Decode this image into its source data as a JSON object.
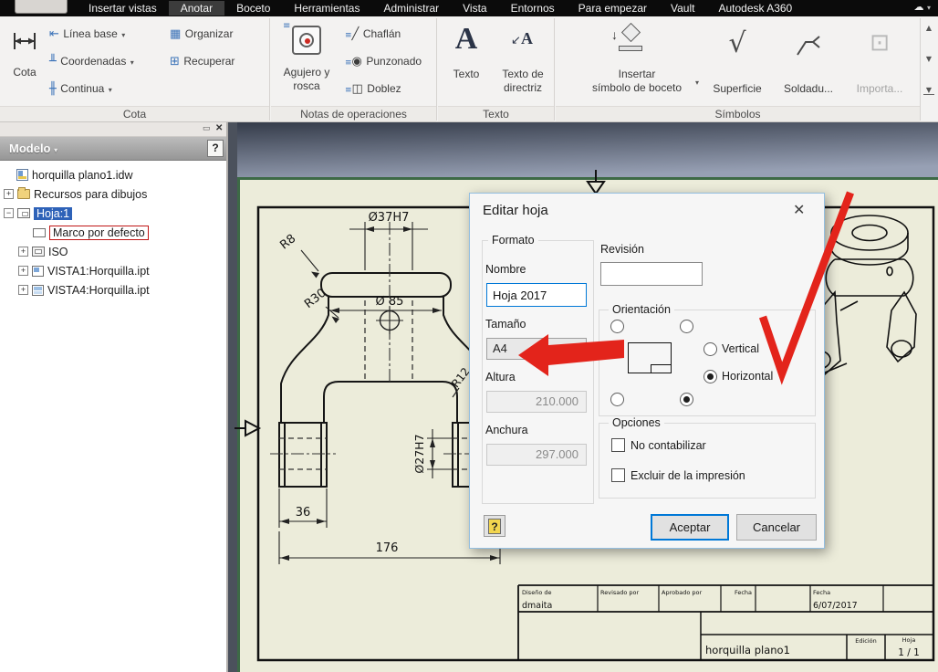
{
  "app": {
    "tabs": {
      "items": [
        "Insertar vistas",
        "Anotar",
        "Boceto",
        "Herramientas",
        "Administrar",
        "Vista",
        "Entornos",
        "Para empezar",
        "Vault",
        "Autodesk A360"
      ],
      "active": "Anotar"
    }
  },
  "ribbon": {
    "groups": {
      "cota": "Cota",
      "notas": "Notas de operaciones",
      "texto": "Texto",
      "simbolos": "Símbolos"
    },
    "cota": {
      "main": "Cota",
      "linea_base": "Línea base",
      "coordenadas": "Coordenadas",
      "continua": "Continua",
      "organizar": "Organizar",
      "recuperar": "Recuperar"
    },
    "notas": {
      "agujero_l1": "Agujero y",
      "agujero_l2": "rosca",
      "chaflan": "Chaflán",
      "punzonado": "Punzonado",
      "doblez": "Doblez"
    },
    "texto": {
      "texto": "Texto",
      "directriz_l1": "Texto de",
      "directriz_l2": "directriz"
    },
    "simbolos": {
      "insertar_l1": "Insertar",
      "insertar_l2": "símbolo de boceto",
      "superficie": "Superficie",
      "soldadura": "Soldadu...",
      "importar": "Importa..."
    }
  },
  "panel": {
    "title": "Modelo",
    "items": [
      {
        "label": "horquilla plano1.idw"
      },
      {
        "label": "Recursos para dibujos"
      },
      {
        "label": "Hoja:1"
      },
      {
        "label": "Marco por defecto"
      },
      {
        "label": "ISO"
      },
      {
        "label": "VISTA1:Horquilla.ipt"
      },
      {
        "label": "VISTA4:Horquilla.ipt"
      }
    ]
  },
  "dialog": {
    "title": "Editar hoja",
    "formato_label": "Formato",
    "nombre_label": "Nombre",
    "nombre_value": "Hoja 2017",
    "tamano_label": "Tamaño",
    "tamano_value": "A4",
    "altura_label": "Altura",
    "altura_value": "210.000",
    "anchura_label": "Anchura",
    "anchura_value": "297.000",
    "revision_label": "Revisión",
    "revision_value": "",
    "orientacion_label": "Orientación",
    "vertical_label": "Vertical",
    "horizontal_label": "Horizontal",
    "orientacion_selected": "Horizontal",
    "opciones_label": "Opciones",
    "opcion_no_contabilizar": "No contabilizar",
    "opcion_excluir": "Excluir de la impresión",
    "aceptar": "Aceptar",
    "cancelar": "Cancelar"
  },
  "canvas": {
    "dimensions": {
      "top_diameter": "Ø37H7",
      "radius_top": "R8",
      "radius_side": "R30",
      "body_diameter": "Ø 85",
      "radius_inner": "R12",
      "bore_diameter": "Ø27H7",
      "leg_width": "36",
      "total_width": "176"
    },
    "titleblock": {
      "diseno_label": "Diseño de",
      "diseno_value": "dmaita",
      "revisado_label": "Revisado por",
      "aprobado_label": "Aprobado por",
      "fecha_label": "Fecha",
      "fecha2_label": "Fecha",
      "fecha_value": "6/07/2017",
      "part_name": "horquilla plano1",
      "edicion_label": "Edición",
      "hoja_label": "Hoja",
      "hoja_value": "1 / 1"
    }
  },
  "icons": {
    "close": "✕",
    "panel_close": "✕",
    "window_box": "▭",
    "dropdown": "▾",
    "modelo_caret": "▾",
    "cloud": "☁",
    "help": "?",
    "scroll_up": "▲",
    "scroll_down": "▼",
    "expand": "+",
    "collapse": "−",
    "superficie": "√",
    "texto_letter": "A",
    "directriz_arrow": "↙",
    "linea_base": "⇤",
    "coordenadas": "╨",
    "continua": "╫",
    "organizar": "▦",
    "recuperar": "⊞",
    "chaflan": "╱",
    "punzonado": "◉",
    "doblez": "◫",
    "importar": "⊡"
  },
  "colors": {
    "annotation_red": "#e3241b",
    "accent_blue": "#0078d7",
    "selection_blue": "#2e62b8",
    "paper": "#ececda"
  }
}
